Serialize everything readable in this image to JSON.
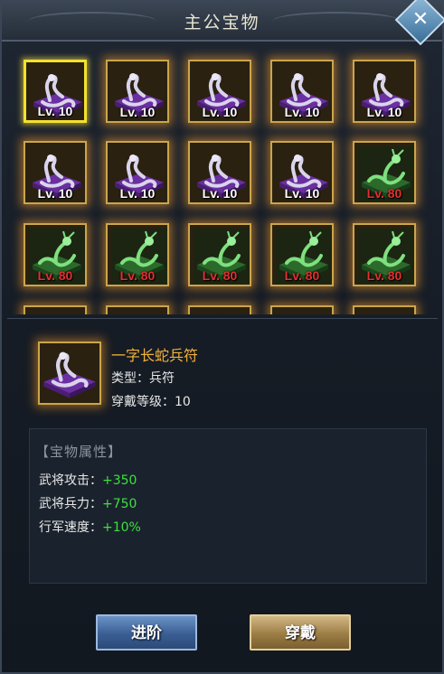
{
  "window": {
    "title": "主公宝物",
    "close_label": "✕"
  },
  "grid": {
    "items": [
      {
        "name": "一字长蛇兵符",
        "kind": "snake",
        "level": "Lv. 10",
        "level_color": "white",
        "selected": true
      },
      {
        "name": "一字长蛇兵符",
        "kind": "snake",
        "level": "Lv. 10",
        "level_color": "white",
        "selected": false
      },
      {
        "name": "一字长蛇兵符",
        "kind": "snake",
        "level": "Lv. 10",
        "level_color": "white",
        "selected": false
      },
      {
        "name": "一字长蛇兵符",
        "kind": "snake",
        "level": "Lv. 10",
        "level_color": "white",
        "selected": false
      },
      {
        "name": "一字长蛇兵符",
        "kind": "snake",
        "level": "Lv. 10",
        "level_color": "white",
        "selected": false
      },
      {
        "name": "一字长蛇兵符",
        "kind": "snake",
        "level": "Lv. 10",
        "level_color": "white",
        "selected": false
      },
      {
        "name": "一字长蛇兵符",
        "kind": "snake",
        "level": "Lv. 10",
        "level_color": "white",
        "selected": false
      },
      {
        "name": "一字长蛇兵符",
        "kind": "snake",
        "level": "Lv. 10",
        "level_color": "white",
        "selected": false
      },
      {
        "name": "一字长蛇兵符",
        "kind": "snake",
        "level": "Lv. 10",
        "level_color": "white",
        "selected": false
      },
      {
        "name": "dragon",
        "kind": "dragon",
        "level": "Lv. 80",
        "level_color": "red",
        "selected": false
      },
      {
        "name": "dragon",
        "kind": "dragon",
        "level": "Lv. 80",
        "level_color": "red",
        "selected": false
      },
      {
        "name": "dragon",
        "kind": "dragon",
        "level": "Lv. 80",
        "level_color": "red",
        "selected": false
      },
      {
        "name": "dragon",
        "kind": "dragon",
        "level": "Lv. 80",
        "level_color": "red",
        "selected": false
      },
      {
        "name": "dragon",
        "kind": "dragon",
        "level": "Lv. 80",
        "level_color": "red",
        "selected": false
      },
      {
        "name": "dragon",
        "kind": "dragon",
        "level": "Lv. 80",
        "level_color": "red",
        "selected": false
      }
    ]
  },
  "detail": {
    "name": "一字长蛇兵符",
    "type": "类型：兵符",
    "level_req": "穿戴等级：10",
    "attr_title": "【宝物属性】",
    "attrs": [
      {
        "label": "武将攻击：",
        "value": "+350"
      },
      {
        "label": "武将兵力：",
        "value": "+750"
      },
      {
        "label": "行军速度：",
        "value": "+10%"
      }
    ]
  },
  "buttons": {
    "advance": "进阶",
    "equip": "穿戴"
  },
  "colors": {
    "gold_text": "#f3b33a",
    "green_value": "#3ee03e",
    "red_level": "#e03030",
    "selected_border": "#f4e12f"
  }
}
